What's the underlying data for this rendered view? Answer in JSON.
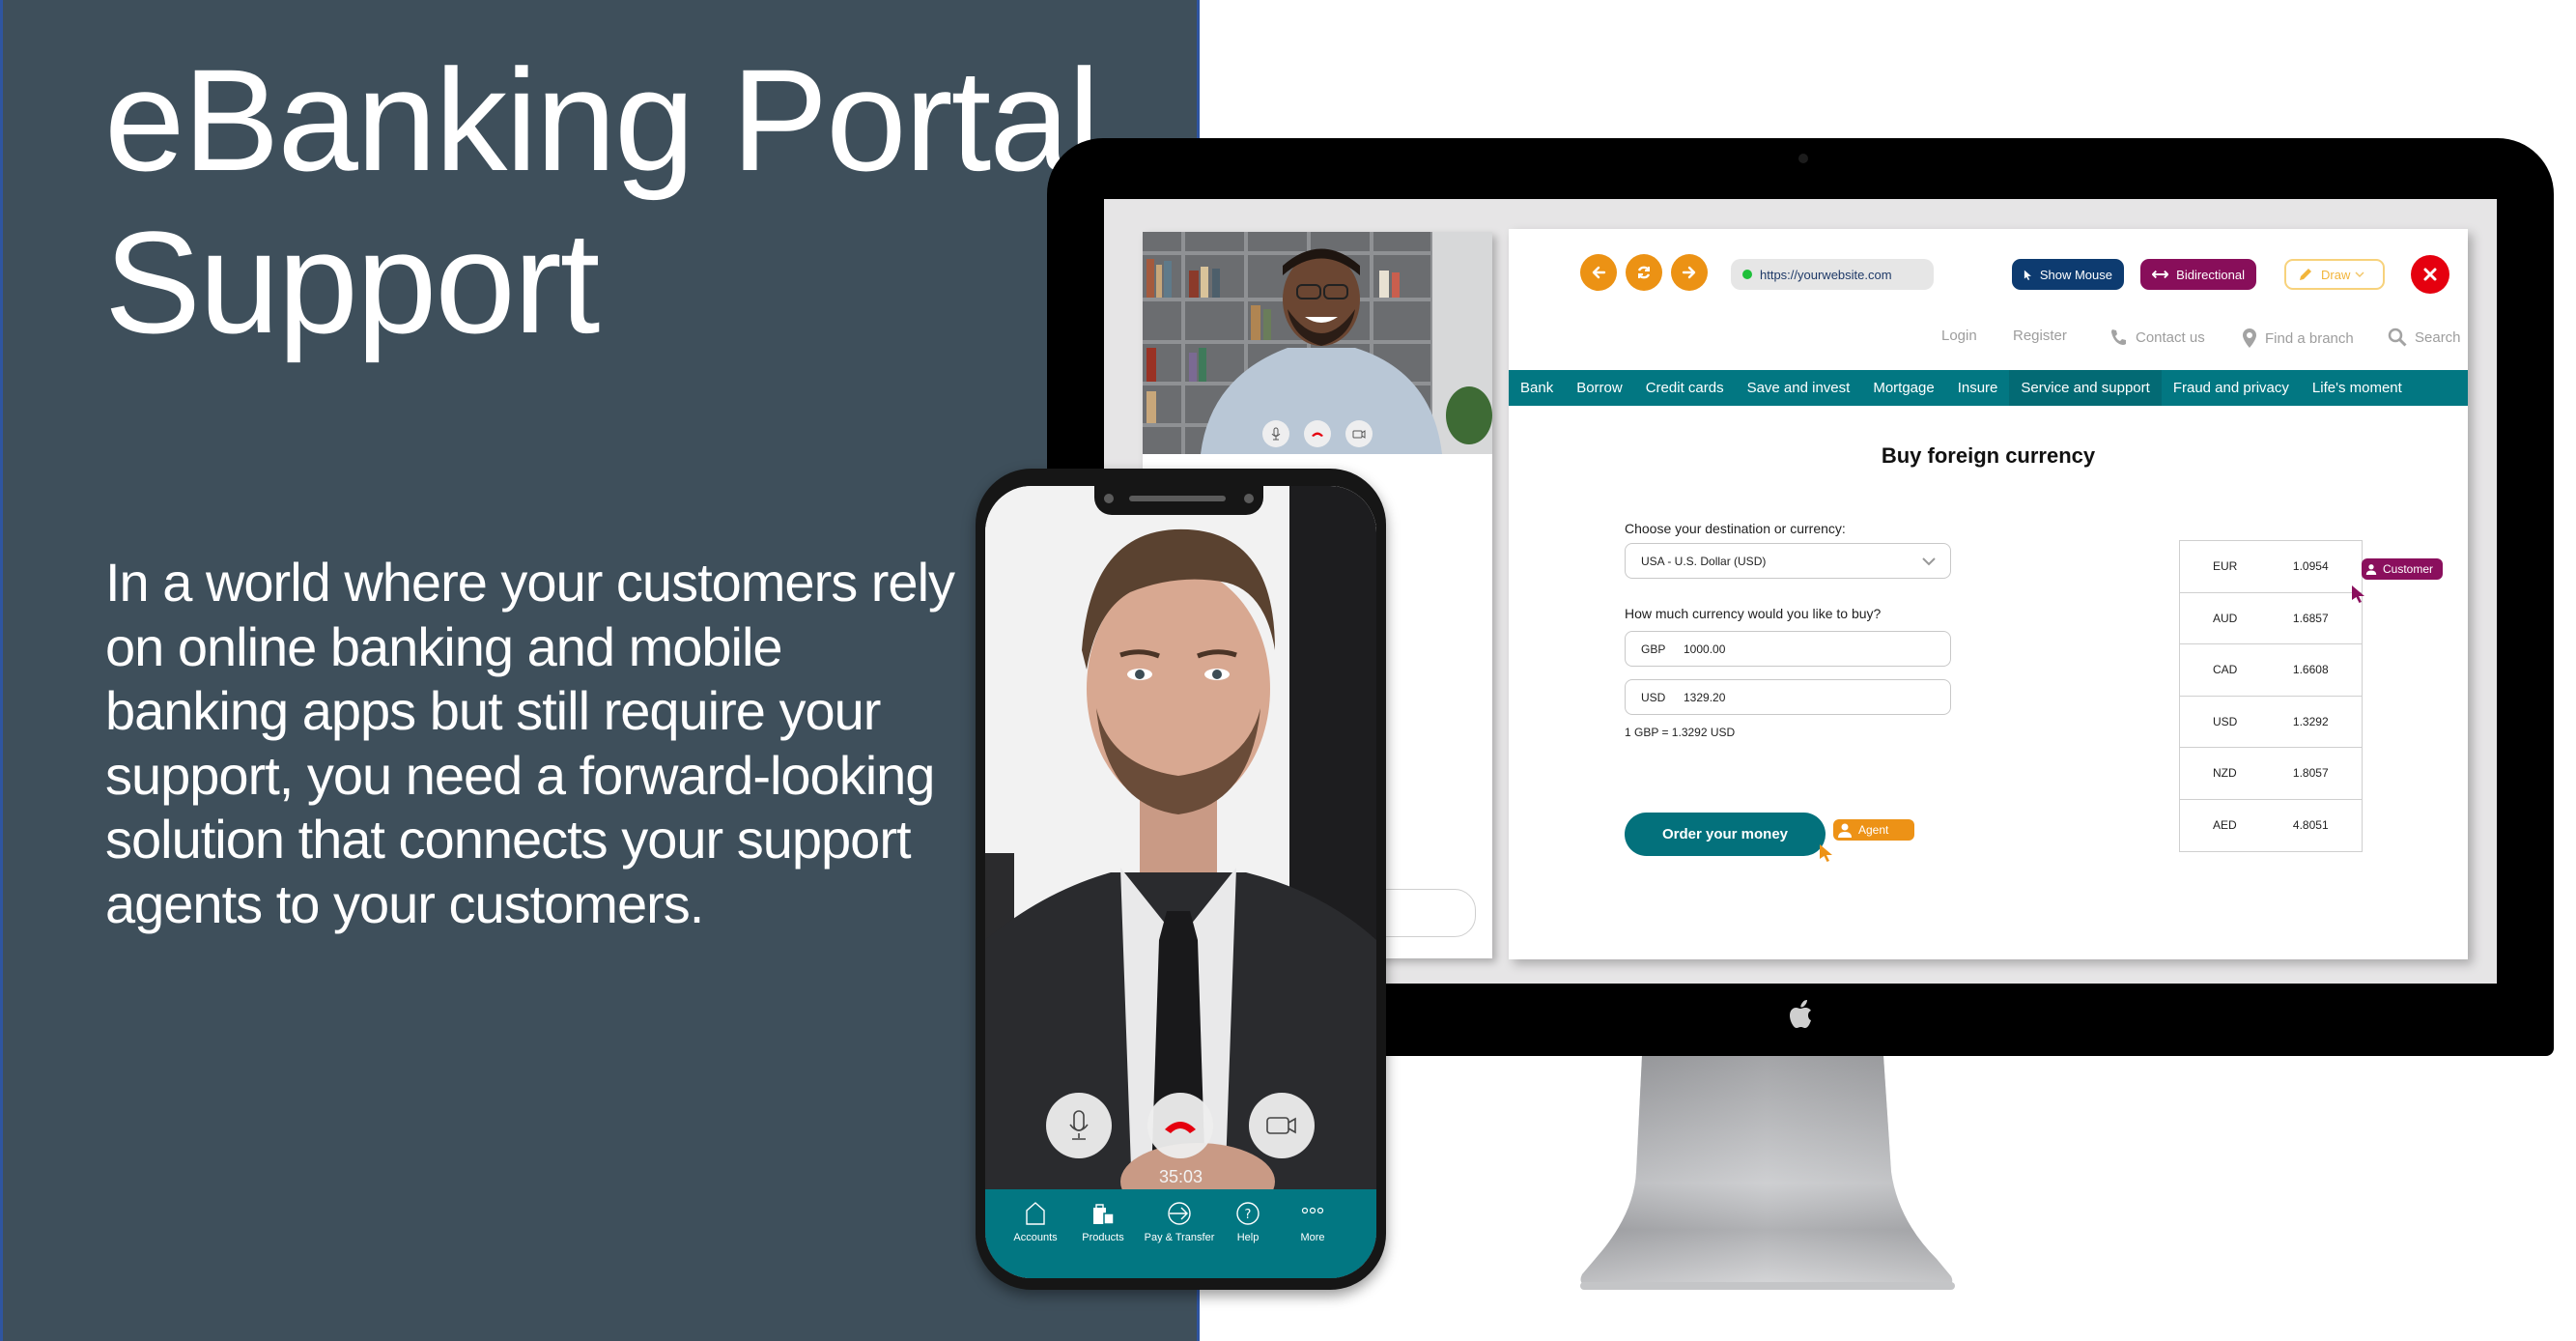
{
  "hero": {
    "title_line1": "eBanking Portal",
    "title_line2": "Support",
    "body": "In a world where your customers rely on online banking and mobile banking apps but still require your support, you need a forward-looking solution that connects your support agents to your customers."
  },
  "colors": {
    "panel_bg": "#3e4f5b",
    "teal": "#027782",
    "orange": "#ec9214",
    "navy": "#0d3b70",
    "magenta": "#880e5a",
    "close_red": "#e5000f"
  },
  "cobrowse_toolbar": {
    "back_icon": "arrow-left-icon",
    "refresh_icon": "refresh-icon",
    "forward_icon": "arrow-right-icon",
    "url": "https://yourwebsite.com",
    "show_mouse_label": "Show Mouse",
    "bidirectional_label": "Bidirectional",
    "draw_label": "Draw",
    "close_icon": "close-icon"
  },
  "site": {
    "top_links": [
      {
        "label": "Login"
      },
      {
        "label": "Register"
      },
      {
        "label": "Contact us",
        "icon": "phone-icon"
      },
      {
        "label": "Find a branch",
        "icon": "location-pin-icon"
      },
      {
        "label": "Search",
        "icon": "search-icon"
      }
    ],
    "menu": [
      {
        "label": "Bank"
      },
      {
        "label": "Borrow"
      },
      {
        "label": "Credit cards"
      },
      {
        "label": "Save and invest"
      },
      {
        "label": "Mortgage"
      },
      {
        "label": "Insure"
      },
      {
        "label": "Service and support",
        "active": true
      },
      {
        "label": "Fraud and privacy"
      },
      {
        "label": "Life's moment"
      }
    ],
    "page_title": "Buy foreign currency",
    "form": {
      "destination_label": "Choose your destination or currency:",
      "destination_value": "USA - U.S. Dollar (USD)",
      "amount_label": "How much currency would you like to buy?",
      "from_currency": "GBP",
      "from_amount": "1000.00",
      "to_currency": "USD",
      "to_amount": "1329.20",
      "rate_note": "1 GBP = 1.3292 USD",
      "order_button": "Order your money"
    },
    "rates": [
      {
        "code": "EUR",
        "rate": "1.0954"
      },
      {
        "code": "AUD",
        "rate": "1.6857"
      },
      {
        "code": "CAD",
        "rate": "1.6608"
      },
      {
        "code": "USD",
        "rate": "1.3292"
      },
      {
        "code": "NZD",
        "rate": "1.8057"
      },
      {
        "code": "AED",
        "rate": "4.8051"
      }
    ],
    "agent_tag": "Agent",
    "customer_tag": "Customer"
  },
  "phone": {
    "call_timer": "35:03",
    "tabs": [
      {
        "label": "Accounts",
        "icon": "home-icon"
      },
      {
        "label": "Products",
        "icon": "shopping-bags-icon"
      },
      {
        "label": "Pay & Transfer",
        "icon": "transfer-arrow-icon"
      },
      {
        "label": "Help",
        "icon": "help-icon"
      },
      {
        "label": "More",
        "icon": "more-dots-icon"
      }
    ]
  }
}
